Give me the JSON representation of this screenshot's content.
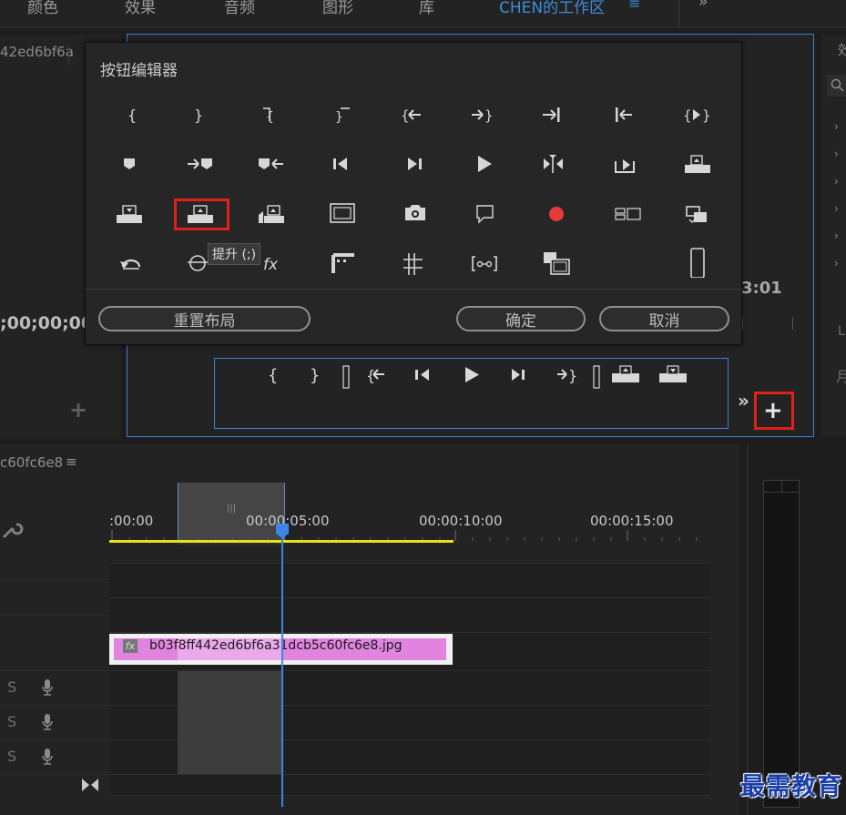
{
  "topbar": {
    "tabs": [
      "颜色",
      "效果",
      "音频",
      "图形",
      "库",
      "CHEN的工作区"
    ],
    "active_tab_menu": "≡",
    "overflow": "»"
  },
  "left_panel": {
    "title": "42ed6bf6a",
    "timecode": ";00;00;00",
    "add": "+"
  },
  "right_panel": {
    "title_char": "效",
    "timecode": "3:01",
    "lower_labels": [
      "L",
      "月"
    ]
  },
  "dialog": {
    "title": "按钮编辑器",
    "tooltip": "提升 (;)",
    "reset_label": "重置布局",
    "ok_label": "确定",
    "cancel_label": "取消",
    "buttons": [
      "add-marker",
      "mark-in",
      "mark-out",
      "clear-in",
      "clear-out",
      "go-to-in",
      "go-to-out",
      "go-to-next-edit",
      "go-to-prev-edit",
      "add-marker-flag",
      "go-to-next-marker",
      "go-to-prev-marker",
      "step-back",
      "step-forward",
      "play-stop",
      "play-around",
      "lift-extract",
      "export-frame-alt",
      "insert",
      "lift",
      "extract",
      "safe-margins",
      "export-frame",
      "captions",
      "record",
      "multi-camera",
      "toggle-proxies",
      "loop",
      "overlay",
      "fx",
      "comparison-view",
      "grid",
      "trim",
      "output",
      "spacer"
    ]
  },
  "transport": {
    "more": "»",
    "add": "+"
  },
  "timeline": {
    "sequence_name": "c60fc6e8",
    "menu": "≡",
    "ruler_labels": [
      ":00:00",
      "00:00:05:00",
      "00:00:10:00",
      "00:00:15:00"
    ],
    "clip_label": "b03f8ff442ed6bf6a31dcb5c60fc6e8.jpg",
    "clip_fx": "fx",
    "audio_track_letter": "S"
  },
  "watermark": "最需教育"
}
